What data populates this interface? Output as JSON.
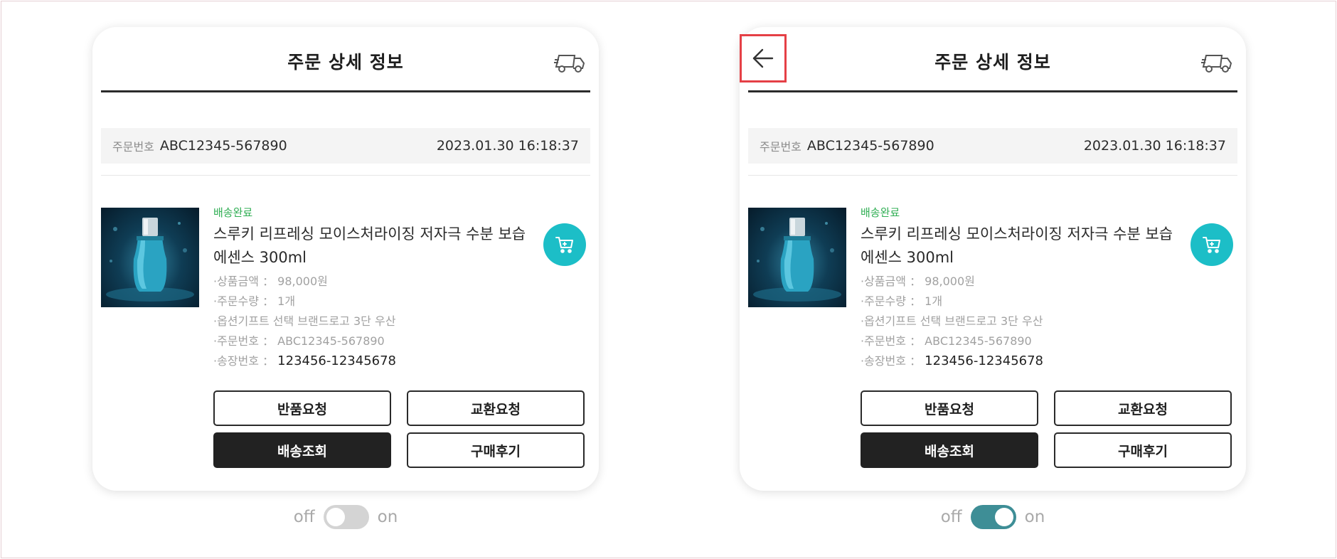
{
  "variants": [
    {
      "header": {
        "title": "주문 상세 정보",
        "truck_icon": "truck-icon",
        "back_icon": null
      },
      "order": {
        "number_label": "주문번호",
        "number": "ABC12345-567890",
        "datetime": "2023.01.30 16:18:37"
      },
      "product": {
        "status": "배송완료",
        "name": "스루키 리프레싱 모이스처라이징 저자극 수분 보습 에센스 300ml",
        "specs": [
          {
            "label": "·상품금액",
            "sep": "：",
            "value": "98,000원"
          },
          {
            "label": "·주문수량",
            "sep": "：",
            "value": "1개"
          },
          {
            "label": "·옵션기프트 선택 브랜드로고 3단 우산",
            "sep": "",
            "value": ""
          },
          {
            "label": "·주문번호",
            "sep": "：",
            "value": "ABC12345-567890"
          },
          {
            "label": "·송장번호",
            "sep": "：",
            "value": "123456-12345678"
          }
        ]
      },
      "actions": {
        "return": "반품요청",
        "exchange": "교환요청",
        "tracking": "배송조회",
        "review": "구매후기"
      },
      "toggle": {
        "off_label": "off",
        "on_label": "on",
        "state": "off"
      }
    },
    {
      "header": {
        "title": "주문 상세 정보",
        "truck_icon": "truck-icon",
        "back_icon": "arrow-left-icon"
      },
      "order": {
        "number_label": "주문번호",
        "number": "ABC12345-567890",
        "datetime": "2023.01.30 16:18:37"
      },
      "product": {
        "status": "배송완료",
        "name": "스루키 리프레싱 모이스처라이징 저자극 수분 보습 에센스 300ml",
        "specs": [
          {
            "label": "·상품금액",
            "sep": "：",
            "value": "98,000원"
          },
          {
            "label": "·주문수량",
            "sep": "：",
            "value": "1개"
          },
          {
            "label": "·옵션기프트 선택 브랜드로고 3단 우산",
            "sep": "",
            "value": ""
          },
          {
            "label": "·주문번호",
            "sep": "：",
            "value": "ABC12345-567890"
          },
          {
            "label": "·송장번호",
            "sep": "：",
            "value": "123456-12345678"
          }
        ]
      },
      "actions": {
        "return": "반품요청",
        "exchange": "교환요청",
        "tracking": "배송조회",
        "review": "구매후기"
      },
      "toggle": {
        "off_label": "off",
        "on_label": "on",
        "state": "on"
      }
    }
  ],
  "colors": {
    "accent_teal": "#1cbec7",
    "toggle_on": "#3e8e96",
    "status_green": "#2fae53",
    "highlight_red": "#e54046"
  }
}
